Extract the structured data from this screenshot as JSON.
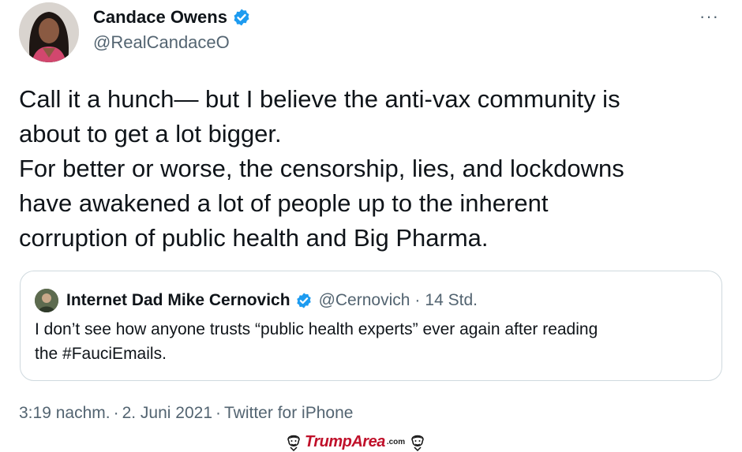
{
  "author": {
    "name": "Candace Owens",
    "handle": "@RealCandaceO",
    "verified": true,
    "avatar_icon": "profile-photo"
  },
  "menu": {
    "more_icon": "more-horizontal-icon",
    "label": "···"
  },
  "tweet": {
    "lines": [
      "Call it a hunch— but I believe the anti-vax community is",
      "about to get a lot bigger.",
      "For better or worse, the censorship, lies, and lockdowns",
      "have awakened a lot of people up to the inherent",
      "corruption of public health and Big Pharma."
    ]
  },
  "quoted_tweet": {
    "name": "Internet Dad Mike Cernovich",
    "handle": "@Cernovich",
    "separator": "·",
    "time": "14 Std.",
    "verified": true,
    "lines": [
      "I don’t see how anyone trusts “public health experts” ever again after reading",
      "the #FauciEmails."
    ]
  },
  "meta": {
    "time": "3:19 nachm.",
    "separator": "·",
    "date": "2. Juni 2021",
    "source": "Twitter for iPhone"
  },
  "watermark": {
    "text": "TrumpArea",
    "suffix": ".com"
  },
  "colors": {
    "text": "#0f1419",
    "secondary": "#536471",
    "verified_blue": "#1d9bf0",
    "border": "#cfd9de",
    "watermark_red": "#c0102a"
  }
}
